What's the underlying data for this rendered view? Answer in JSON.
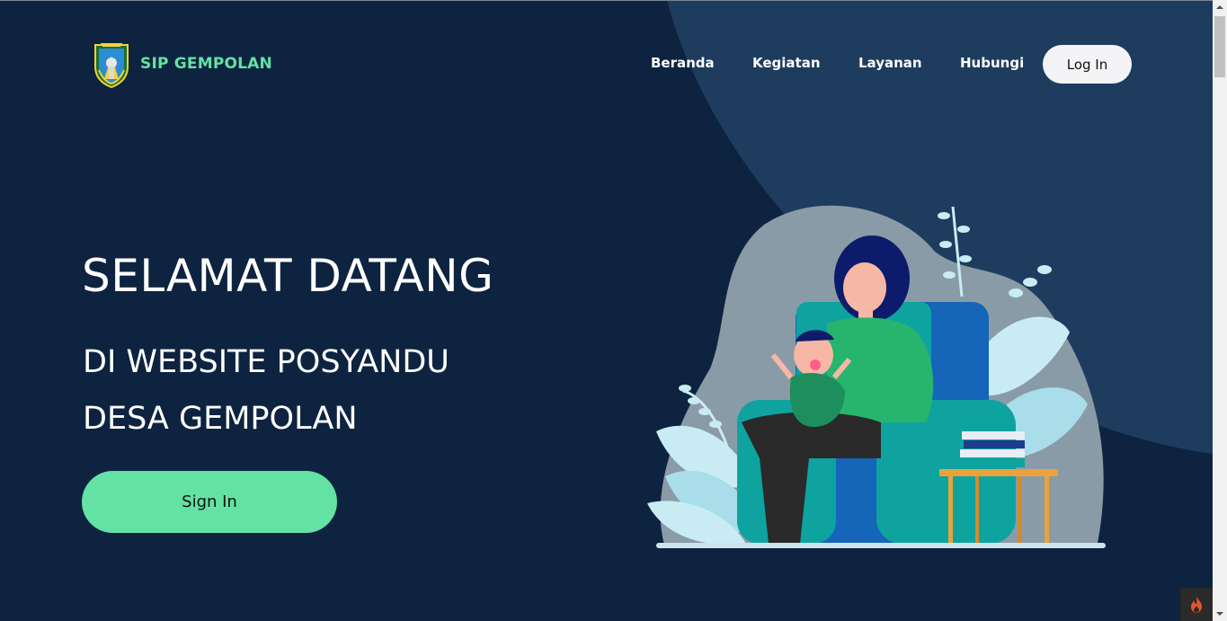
{
  "brand": {
    "name": "SIP GEMPOLAN",
    "logo_icon": "regency-crest-icon"
  },
  "nav": {
    "items": [
      {
        "label": "Beranda"
      },
      {
        "label": "Kegiatan"
      },
      {
        "label": "Layanan"
      },
      {
        "label": "Hubungi"
      }
    ],
    "login_label": "Log In"
  },
  "hero": {
    "title": "SELAMAT DATANG",
    "line1": "DI WEBSITE POSYANDU",
    "line2": "DESA GEMPOLAN",
    "signin_label": "Sign In",
    "illustration": "mother-with-baby-illustration"
  },
  "colors": {
    "background": "#0d2340",
    "accent": "#63e2a3",
    "curve": "#1e3c5e",
    "login_button": "#f4f4f6"
  },
  "toolbar": {
    "debug_icon": "flame-icon"
  }
}
